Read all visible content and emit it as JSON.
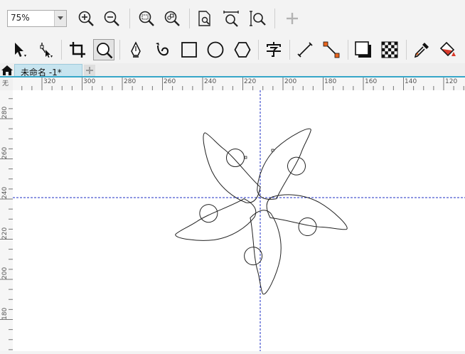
{
  "zoom": {
    "value": "75%"
  },
  "document": {
    "tab_name": "未命名 -1*"
  },
  "corner_label": "无",
  "rulers": {
    "horizontal_labels": [
      "320",
      "300",
      "280",
      "260",
      "240",
      "220",
      "200",
      "180",
      "160",
      "140",
      "120"
    ],
    "vertical_labels": [
      "280",
      "260",
      "240",
      "220",
      "200",
      "180"
    ]
  },
  "colors": {
    "guide": "#1e2fc4",
    "tab": "#c7e4ef",
    "accent": "#37a7c8",
    "node": "#e9651e"
  }
}
